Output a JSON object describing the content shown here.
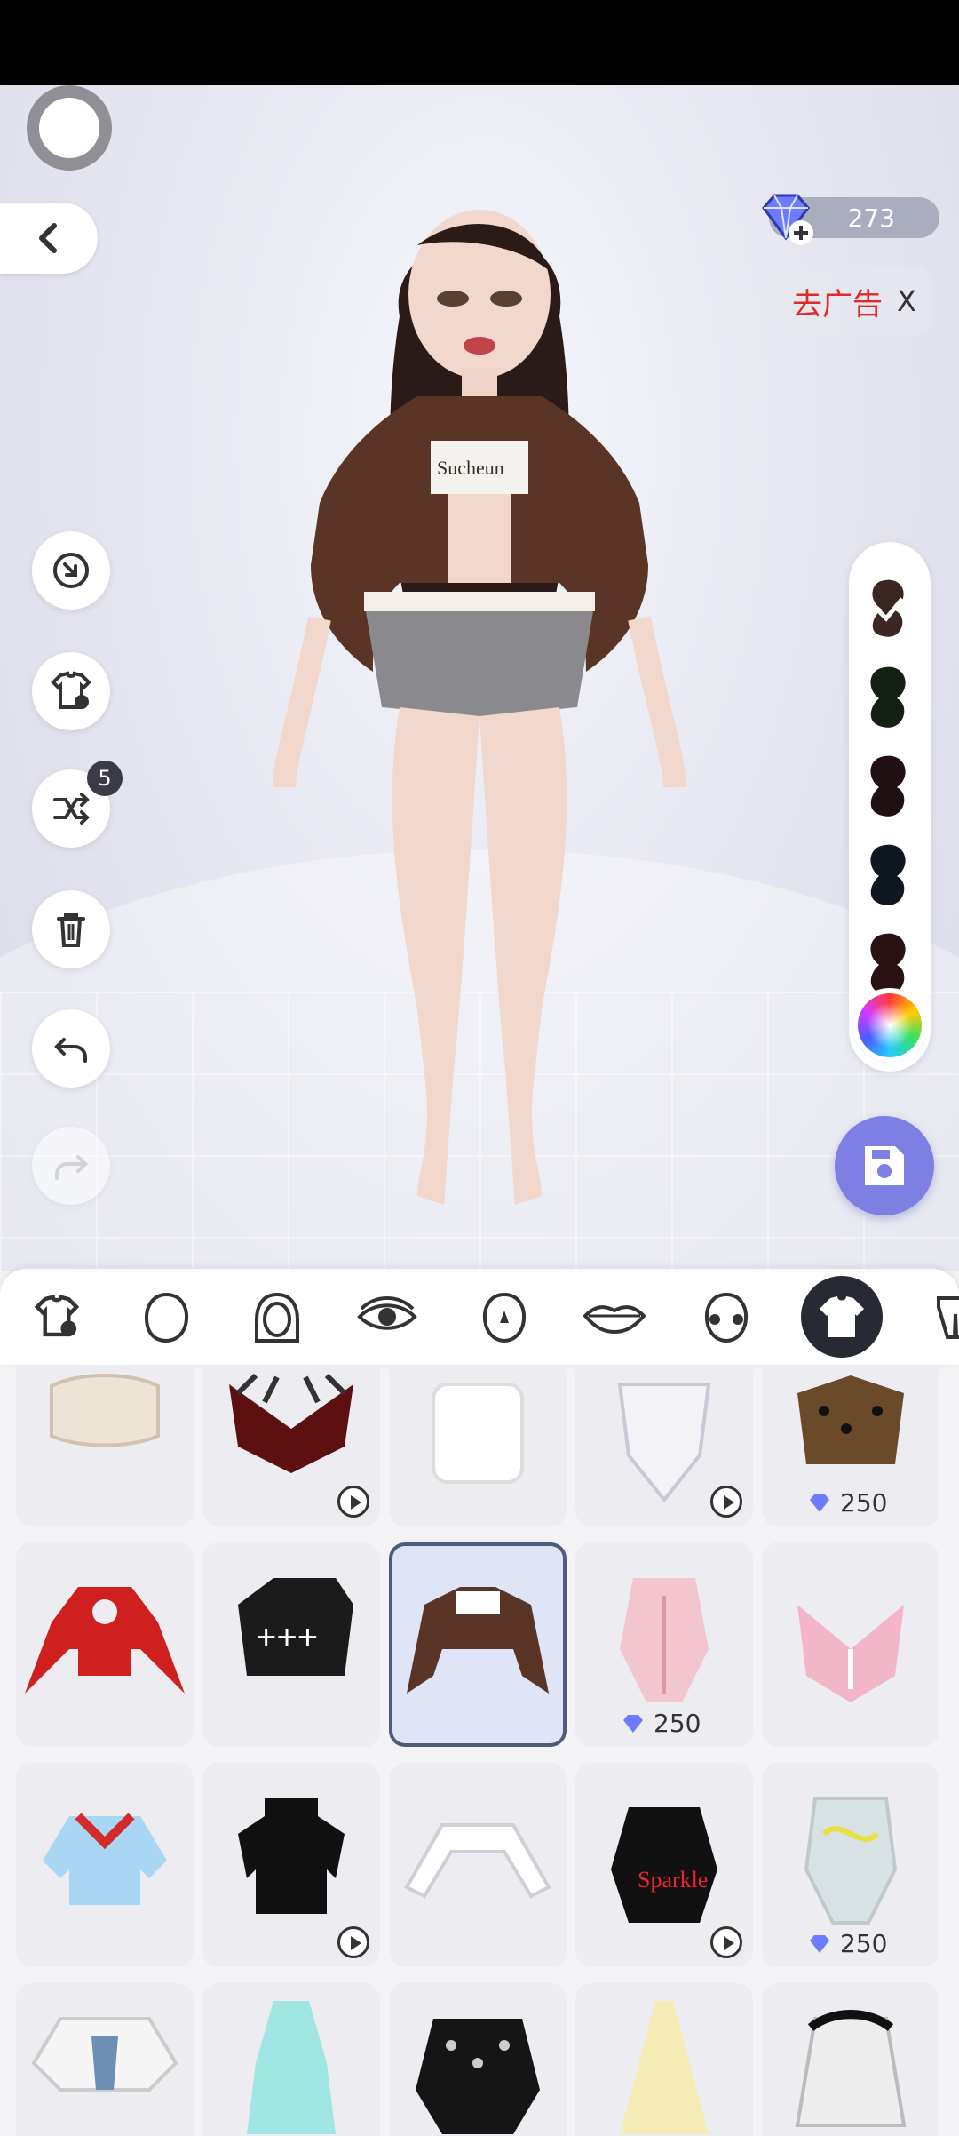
{
  "header": {
    "gems_count": "273",
    "ad_label": "去广告",
    "ad_close": "X"
  },
  "toolbar_left": {
    "shuffle_badge": "5"
  },
  "colors": {
    "hair_swatches": [
      "#3a2623",
      "#142014",
      "#1f1013",
      "#0f1820",
      "#2a1114"
    ],
    "accent": "#7d7fe3"
  },
  "tabs": [
    {
      "name": "saved-look"
    },
    {
      "name": "face-shape"
    },
    {
      "name": "hair"
    },
    {
      "name": "eyes"
    },
    {
      "name": "nose"
    },
    {
      "name": "lips"
    },
    {
      "name": "face-paint"
    },
    {
      "name": "tops",
      "active": true
    },
    {
      "name": "bottoms"
    }
  ],
  "items": [
    {
      "id": "r1c1",
      "price": null,
      "video": false
    },
    {
      "id": "r1c2",
      "price": null,
      "video": true
    },
    {
      "id": "r1c3",
      "price": null,
      "video": false
    },
    {
      "id": "r1c4",
      "price": null,
      "video": true
    },
    {
      "id": "r1c5",
      "price": "250",
      "video": false
    },
    {
      "id": "r2c1",
      "price": null,
      "video": false
    },
    {
      "id": "r2c2",
      "price": null,
      "video": false
    },
    {
      "id": "r2c3",
      "price": null,
      "video": false,
      "selected": true
    },
    {
      "id": "r2c4",
      "price": "250",
      "video": false
    },
    {
      "id": "r2c5",
      "price": null,
      "video": false
    },
    {
      "id": "r3c1",
      "price": null,
      "video": false
    },
    {
      "id": "r3c2",
      "price": null,
      "video": true
    },
    {
      "id": "r3c3",
      "price": null,
      "video": false
    },
    {
      "id": "r3c4",
      "price": null,
      "video": true
    },
    {
      "id": "r3c5",
      "price": "250",
      "video": false
    },
    {
      "id": "r4c1",
      "price": null,
      "video": false
    },
    {
      "id": "r4c2",
      "price": null,
      "video": false
    },
    {
      "id": "r4c3",
      "price": null,
      "video": false
    },
    {
      "id": "r4c4",
      "price": null,
      "video": false
    },
    {
      "id": "r4c5",
      "price": null,
      "video": false
    }
  ],
  "item_prices": {
    "r1c5": "250",
    "r2c4": "250",
    "r3c5": "250"
  }
}
